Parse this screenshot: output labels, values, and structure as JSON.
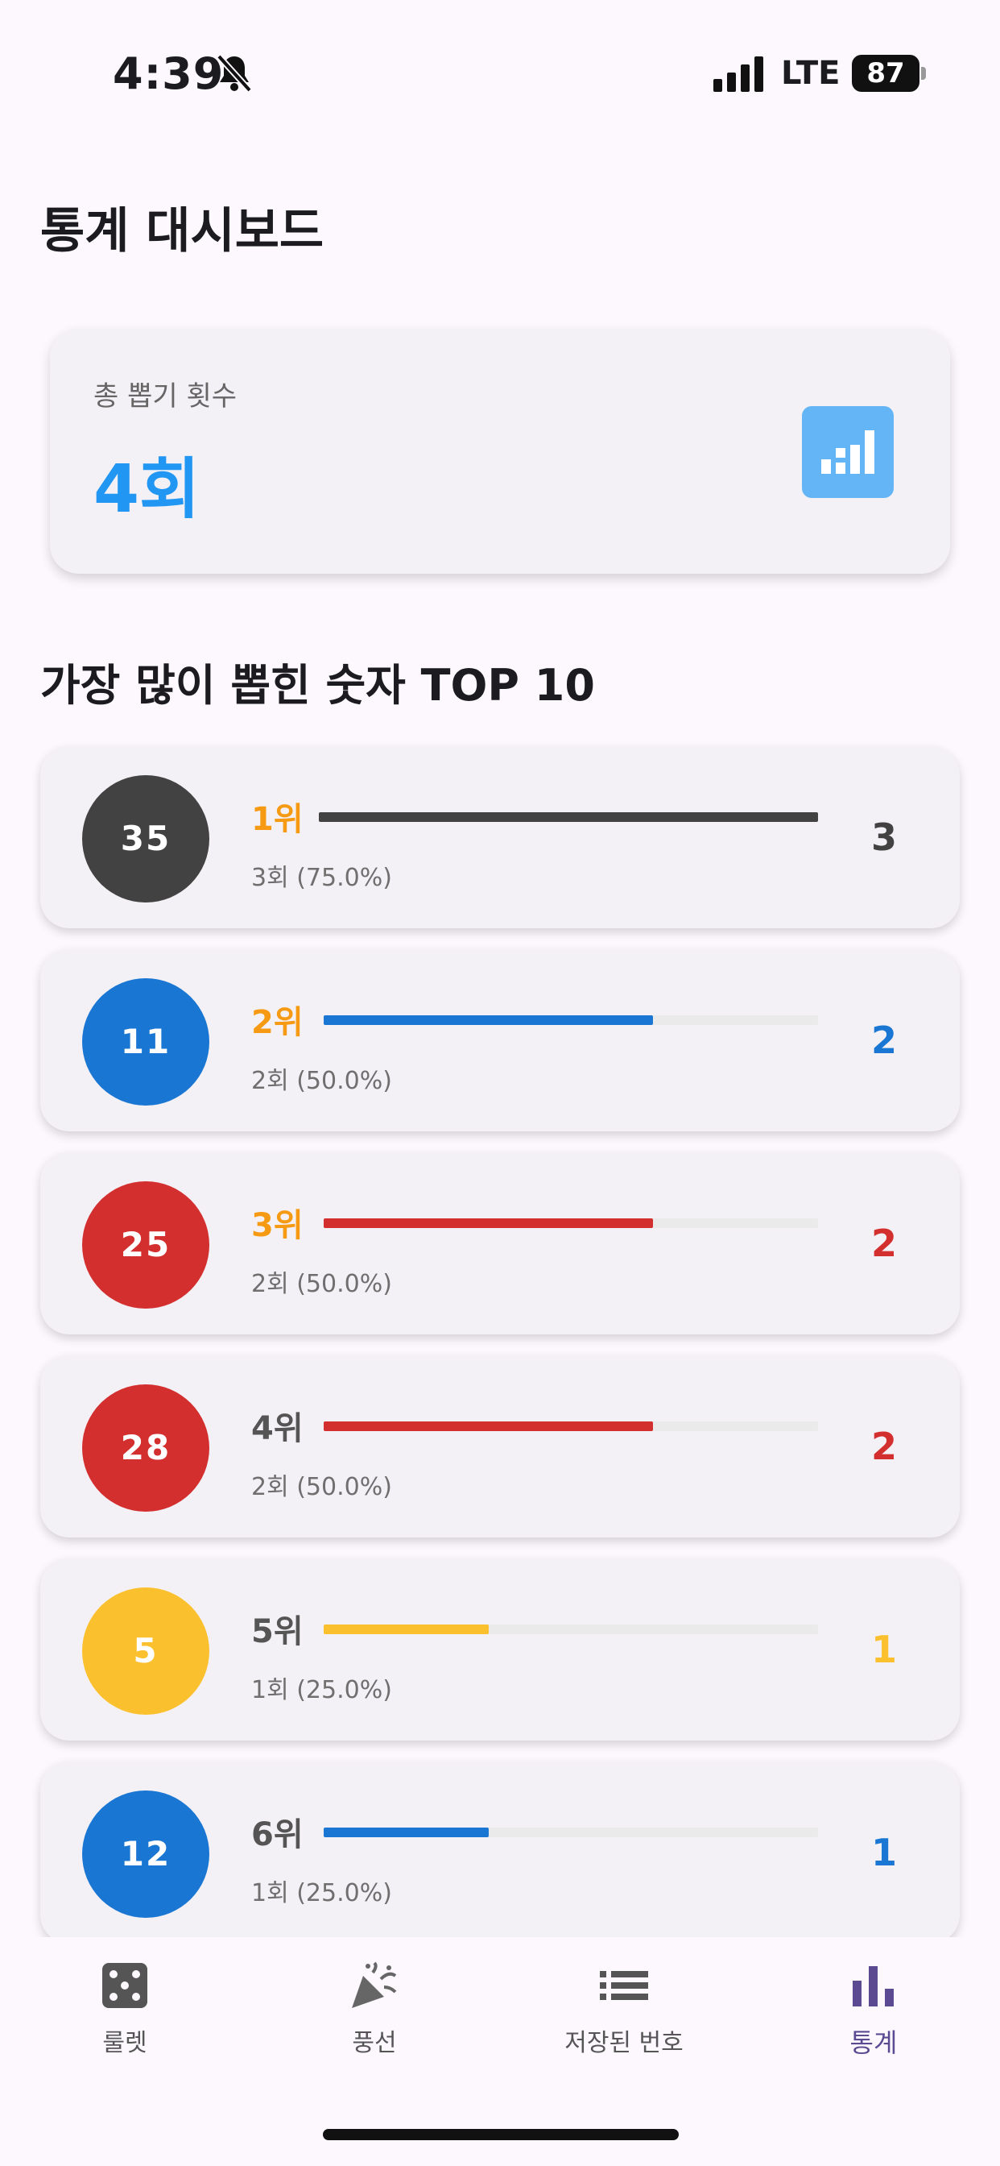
{
  "status_bar": {
    "time": "4:39",
    "network": "LTE",
    "battery": "87"
  },
  "page": {
    "title": "통계 대시보드"
  },
  "summary": {
    "label": "총 뽑기 횟수",
    "value": "4회",
    "icon": "bar-chart-icon",
    "icon_bg": "#64b5f6"
  },
  "section": {
    "title": "가장 많이 뽑힌 숫자 TOP 10"
  },
  "ranking": [
    {
      "number": "35",
      "rank": "1위",
      "detail": "3회 (75.0%)",
      "count": "3",
      "fraction": 1.0,
      "ball_color": "#424242",
      "rank_color": "#f59a12",
      "count_color": "#424242"
    },
    {
      "number": "11",
      "rank": "2위",
      "detail": "2회 (50.0%)",
      "count": "2",
      "fraction": 0.6667,
      "ball_color": "#1976d2",
      "rank_color": "#f59a12",
      "count_color": "#1976d2"
    },
    {
      "number": "25",
      "rank": "3위",
      "detail": "2회 (50.0%)",
      "count": "2",
      "fraction": 0.6667,
      "ball_color": "#d32f2f",
      "rank_color": "#f59a12",
      "count_color": "#d32f2f"
    },
    {
      "number": "28",
      "rank": "4위",
      "detail": "2회 (50.0%)",
      "count": "2",
      "fraction": 0.6667,
      "ball_color": "#d32f2f",
      "rank_color": "#555555",
      "count_color": "#d32f2f"
    },
    {
      "number": "5",
      "rank": "5위",
      "detail": "1회 (25.0%)",
      "count": "1",
      "fraction": 0.3333,
      "ball_color": "#fbc02d",
      "rank_color": "#555555",
      "count_color": "#fbc02d"
    },
    {
      "number": "12",
      "rank": "6위",
      "detail": "1회 (25.0%)",
      "count": "1",
      "fraction": 0.3333,
      "ball_color": "#1976d2",
      "rank_color": "#555555",
      "count_color": "#1976d2"
    }
  ],
  "nav": {
    "items": [
      {
        "label": "룰렛",
        "icon": "dice-icon"
      },
      {
        "label": "풍선",
        "icon": "party-popper-icon"
      },
      {
        "label": "저장된 번호",
        "icon": "list-icon"
      },
      {
        "label": "통계",
        "icon": "bar-chart-icon"
      }
    ],
    "active_color": "#5b4a91"
  }
}
